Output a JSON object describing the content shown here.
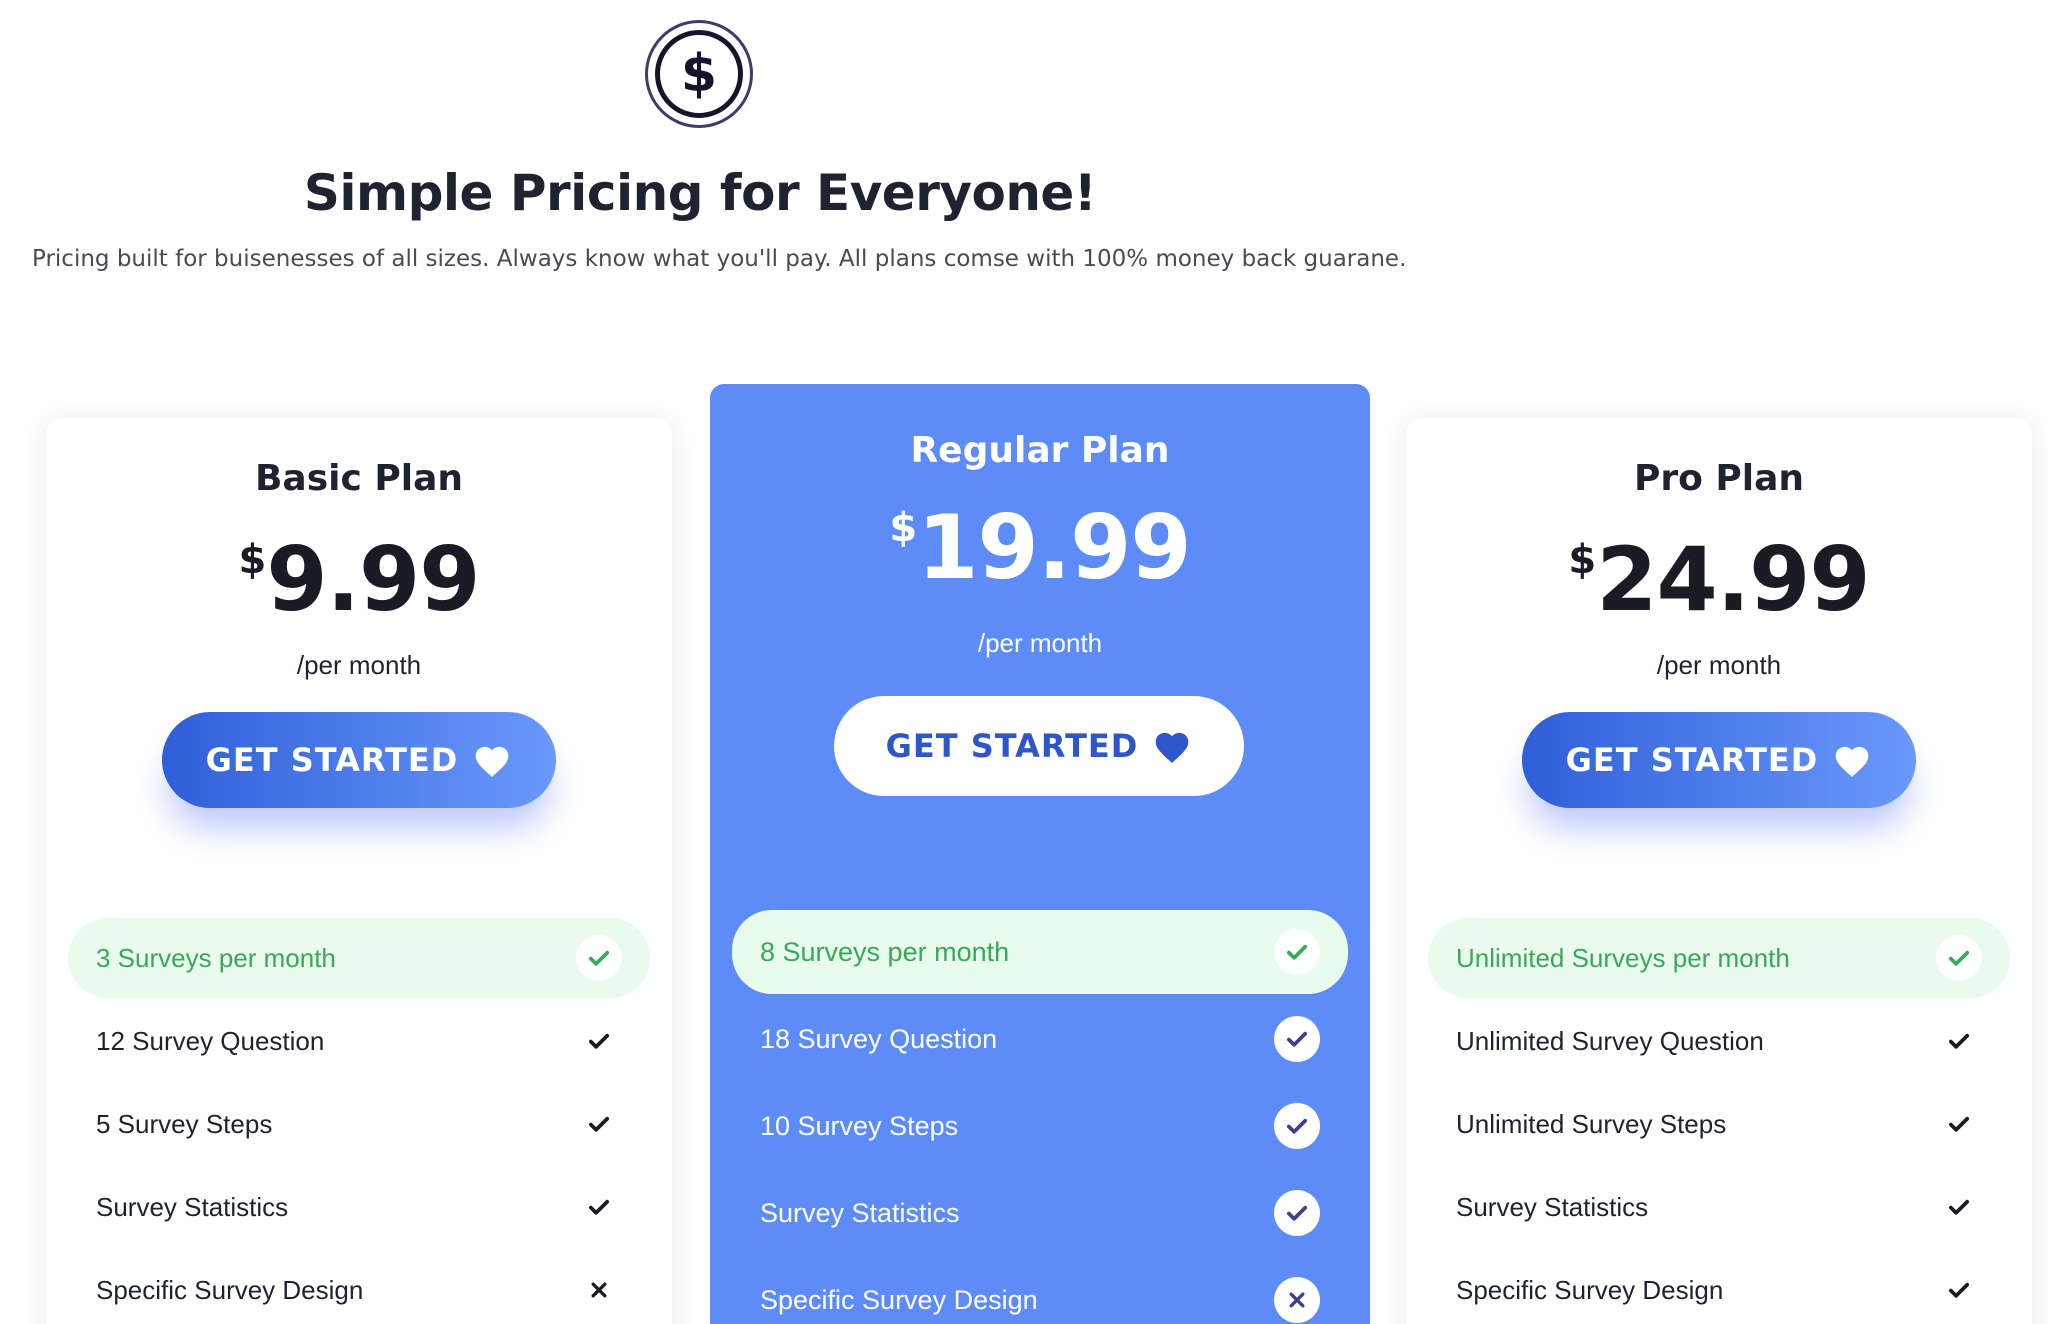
{
  "header": {
    "logo_icon": "dollar-coin-icon",
    "logo_glyph": "$",
    "title": "Simple Pricing for Everyone!",
    "subtitle": "Pricing built for buisenesses of all sizes. Always know what you'll pay. All plans comse with 100% money back guarane."
  },
  "colors": {
    "accent_blue": "#5d8cf8",
    "button_gradient_start": "#2f5fd8",
    "button_gradient_end": "#6a99fb",
    "check_green": "#3aa85b",
    "highlight_bg": "#eafbee"
  },
  "plans": [
    {
      "name": "Basic Plan",
      "currency": "$",
      "price": "9.99",
      "period": "/per month",
      "cta": "GET STARTED",
      "cta_icon": "heart-icon",
      "features": [
        {
          "label": "3 Surveys per month",
          "included": true,
          "highlight": true
        },
        {
          "label": "12 Survey Question",
          "included": true
        },
        {
          "label": "5 Survey Steps",
          "included": true
        },
        {
          "label": "Survey Statistics",
          "included": true
        },
        {
          "label": "Specific Survey Design",
          "included": false
        }
      ]
    },
    {
      "name": "Regular Plan",
      "currency": "$",
      "price": "19.99",
      "period": "/per month",
      "cta": "GET STARTED",
      "cta_icon": "heart-icon",
      "features": [
        {
          "label": "8 Surveys per month",
          "included": true,
          "highlight": true
        },
        {
          "label": "18 Survey Question",
          "included": true
        },
        {
          "label": "10 Survey Steps",
          "included": true
        },
        {
          "label": "Survey Statistics",
          "included": true
        },
        {
          "label": "Specific Survey Design",
          "included": false
        }
      ]
    },
    {
      "name": "Pro Plan",
      "currency": "$",
      "price": "24.99",
      "period": "/per month",
      "cta": "GET STARTED",
      "cta_icon": "heart-icon",
      "features": [
        {
          "label": "Unlimited Surveys per month",
          "included": true,
          "highlight": true
        },
        {
          "label": "Unlimited Survey Question",
          "included": true
        },
        {
          "label": "Unlimited Survey Steps",
          "included": true
        },
        {
          "label": "Survey Statistics",
          "included": true
        },
        {
          "label": "Specific Survey Design",
          "included": true
        }
      ]
    }
  ]
}
